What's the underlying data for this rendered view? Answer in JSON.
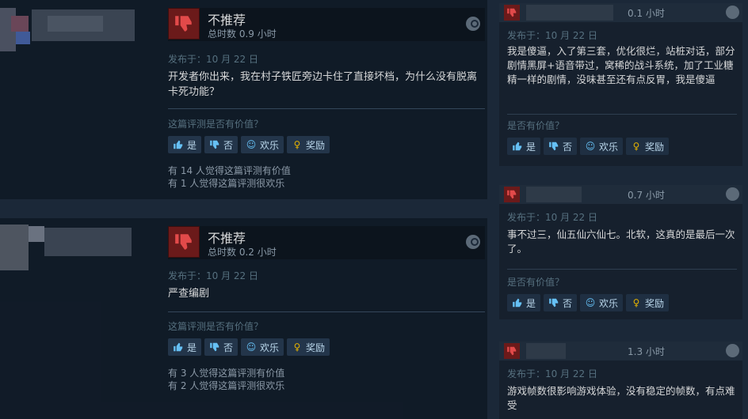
{
  "reviews": [
    {
      "verdict": "不推荐",
      "playtime": "总时数 0.9 小时",
      "posted": "发布于：10 月 22 日",
      "content": "开发者你出来，我在村子铁匠旁边卡住了直接坏档，为什么没有脱离卡死功能？",
      "helpful_question": "这篇评测是否有价值？",
      "votes": {
        "yes": "是",
        "no": "否",
        "funny": "欢乐",
        "award": "奖励"
      },
      "stats": [
        "有 14 人觉得这篇评测有价值",
        "有 1 人觉得这篇评测很欢乐"
      ]
    },
    {
      "verdict": "不推荐",
      "playtime": "总时数 0.2 小时",
      "posted": "发布于：10 月 22 日",
      "content": "严查编剧",
      "helpful_question": "这篇评测是否有价值？",
      "votes": {
        "yes": "是",
        "no": "否",
        "funny": "欢乐",
        "award": "奖励"
      },
      "stats": [
        "有 3 人觉得这篇评测有价值",
        "有 2 人觉得这篇评测很欢乐"
      ]
    }
  ],
  "recent_reviews": [
    {
      "hours": "0.1 小时",
      "posted": "发布于：10 月 22 日",
      "content": "我是傻逼，入了第三套，优化很烂，站桩对话，部分剧情黑屏+语音带过，窝稀的战斗系统，加了工业糖精一样的剧情，没味甚至还有点反胃，我是傻逼",
      "helpful_question": "是否有价值？",
      "votes": {
        "yes": "是",
        "no": "否",
        "funny": "欢乐",
        "award": "奖励"
      }
    },
    {
      "hours": "0.7 小时",
      "posted": "发布于：10 月 22 日",
      "content": "事不过三，仙五仙六仙七。北软，这真的是最后一次了。",
      "helpful_question": "是否有价值？",
      "votes": {
        "yes": "是",
        "no": "否",
        "funny": "欢乐",
        "award": "奖励"
      }
    },
    {
      "hours": "1.3 小时",
      "posted": "发布于：10 月 22 日",
      "content": "游戏帧数很影响游戏体验，没有稳定的帧数，有点难受"
    }
  ],
  "icons": {
    "thumbs_down": "thumbs-down-icon",
    "thumbs_up": "thumbs-up-icon",
    "smile": "smile-icon",
    "award": "award-icon",
    "steam": "steam-logo-icon"
  },
  "colors": {
    "background": "#1b2838",
    "negative": "#6b1a1a",
    "link": "#66c0f4",
    "award": "#e2b000"
  }
}
